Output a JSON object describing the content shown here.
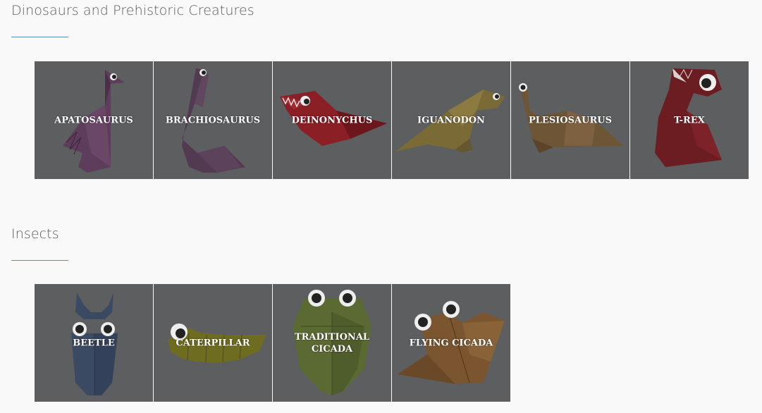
{
  "sections": [
    {
      "title": "Dinosaurs and Prehistoric Creatures",
      "items": [
        {
          "label": "APATOSAURUS",
          "color": "#5e3d5c"
        },
        {
          "label": "BRACHIOSAURUS",
          "color": "#523a50"
        },
        {
          "label": "DEINONYCHUS",
          "color": "#8a1f26"
        },
        {
          "label": "IGUANODON",
          "color": "#7a6b36"
        },
        {
          "label": "PLESIOSAURUS",
          "color": "#6e5535"
        },
        {
          "label": "T-REX",
          "color": "#6b1d22"
        }
      ]
    },
    {
      "title": "Insects",
      "items": [
        {
          "label": "BEETLE",
          "color": "#3b4a63"
        },
        {
          "label": "CATERPILLAR",
          "color": "#6e6c20"
        },
        {
          "label": "TRADITIONAL CICADA",
          "color": "#5b6a32"
        },
        {
          "label": "FLYING CICADA",
          "color": "#7a5530"
        }
      ]
    }
  ]
}
